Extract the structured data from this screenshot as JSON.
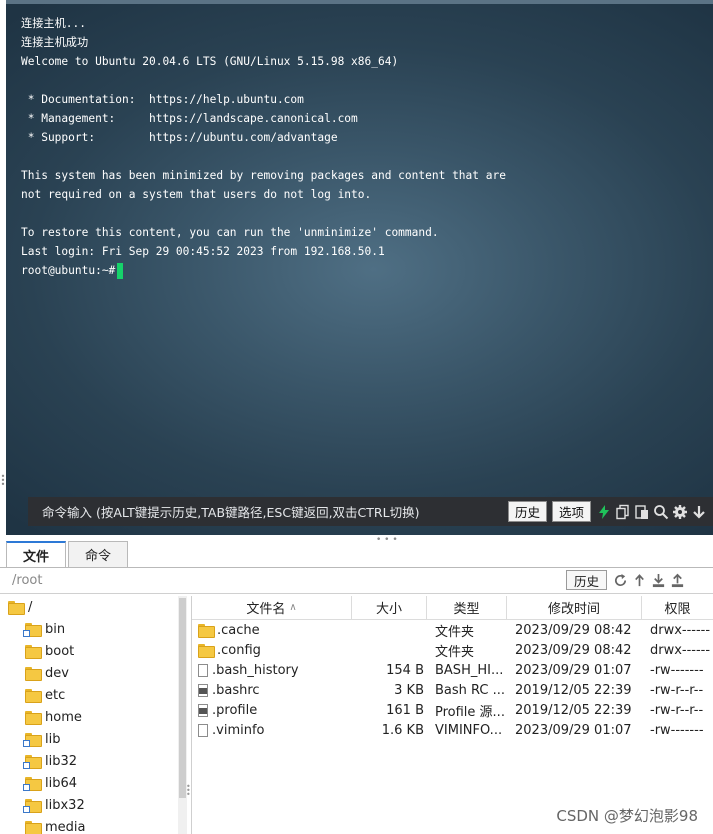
{
  "terminal": {
    "lines": [
      "连接主机...",
      "连接主机成功",
      "Welcome to Ubuntu 20.04.6 LTS (GNU/Linux 5.15.98 x86_64)",
      "",
      " * Documentation:  https://help.ubuntu.com",
      " * Management:     https://landscape.canonical.com",
      " * Support:        https://ubuntu.com/advantage",
      "",
      "This system has been minimized by removing packages and content that are",
      "not required on a system that users do not log into.",
      "",
      "To restore this content, you can run the 'unminimize' command.",
      "Last login: Fri Sep 29 00:45:52 2023 from 192.168.50.1"
    ],
    "prompt": "root@ubuntu:~#",
    "cursor_color": "#16d26a"
  },
  "cmdbar": {
    "placeholder": "命令输入 (按ALT键提示历史,TAB键路径,ESC键返回,双击CTRL切换)",
    "history_label": "历史",
    "options_label": "选项"
  },
  "tabs": [
    {
      "label": "文件",
      "active": true
    },
    {
      "label": "命令",
      "active": false
    }
  ],
  "pathbar": {
    "path": "/root",
    "history_label": "历史"
  },
  "tree": {
    "root": "/",
    "children": [
      "bin",
      "boot",
      "dev",
      "etc",
      "home",
      "lib",
      "lib32",
      "lib64",
      "libx32",
      "media"
    ]
  },
  "files": {
    "columns": [
      "文件名",
      "大小",
      "类型",
      "修改时间",
      "权限"
    ],
    "rows": [
      {
        "name": ".cache",
        "size": "",
        "type": "文件夹",
        "modified": "2023/09/29 08:42",
        "perm": "drwx------",
        "icon": "folder-icon"
      },
      {
        "name": ".config",
        "size": "",
        "type": "文件夹",
        "modified": "2023/09/29 08:42",
        "perm": "drwx------",
        "icon": "folder-icon"
      },
      {
        "name": ".bash_history",
        "size": "154 B",
        "type": "BASH_HI...",
        "modified": "2023/09/29 01:07",
        "perm": "-rw-------",
        "icon": "file-icon"
      },
      {
        "name": ".bashrc",
        "size": "3 KB",
        "type": "Bash RC ...",
        "modified": "2019/12/05 22:39",
        "perm": "-rw-r--r--",
        "icon": "config-file-icon"
      },
      {
        "name": ".profile",
        "size": "161 B",
        "type": "Profile 源...",
        "modified": "2019/12/05 22:39",
        "perm": "-rw-r--r--",
        "icon": "config-file-icon"
      },
      {
        "name": ".viminfo",
        "size": "1.6 KB",
        "type": "VIMINFO...",
        "modified": "2023/09/29 01:07",
        "perm": "-rw-------",
        "icon": "file-icon"
      }
    ]
  },
  "watermark": "CSDN @梦幻泡影98"
}
